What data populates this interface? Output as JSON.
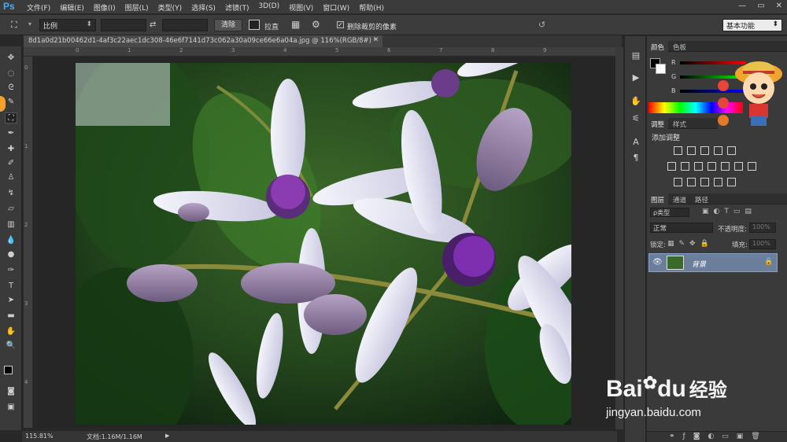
{
  "app": {
    "logo": "Ps"
  },
  "menu": [
    "文件(F)",
    "编辑(E)",
    "图像(I)",
    "图层(L)",
    "类型(Y)",
    "选择(S)",
    "滤镜(T)",
    "3D(D)",
    "视图(V)",
    "窗口(W)",
    "帮助(H)"
  ],
  "options": {
    "ratio_value": "比例",
    "clear_label": "清除",
    "straighten_label": "拉直",
    "delete_cropped_label": "删除裁剪的像素",
    "delete_cropped_checked": true,
    "workspace": "基本功能"
  },
  "document": {
    "tab_title": "8d1a0d21b00462d1-4af3c22aec1dc308-46e6f7141d73c062a30a09ce66e6a04a.jpg @ 116%(RGB/8#) *",
    "zoom": "115.81%",
    "doc_size": "文档:1.16M/1.16M"
  },
  "ruler": {
    "top": [
      "0",
      "1",
      "2",
      "3",
      "4",
      "5",
      "6",
      "7",
      "8",
      "9"
    ],
    "left": [
      "0",
      "1",
      "2",
      "3",
      "4"
    ]
  },
  "color_panel": {
    "tabs": [
      "颜色",
      "色板"
    ],
    "channels": [
      "R",
      "G",
      "B"
    ]
  },
  "adjust_panel": {
    "tabs": [
      "调整",
      "样式"
    ],
    "title": "添加调整"
  },
  "layers_panel": {
    "tabs": [
      "图层",
      "通道",
      "路径"
    ],
    "filter_kind": "ρ类型",
    "blend_mode": "正常",
    "opacity_label": "不透明度:",
    "opacity_value": "100%",
    "lock_label": "锁定:",
    "fill_label": "填充:",
    "fill_value": "100%",
    "layer_name": "背景"
  },
  "watermark": {
    "brand": "Bai",
    "brand2": "du",
    "suffix": "经验",
    "url": "jingyan.baidu.com"
  },
  "colors": {
    "accent": "#4ea8f5",
    "layer_selected": "#6b7f9c",
    "bg": "#282828"
  }
}
